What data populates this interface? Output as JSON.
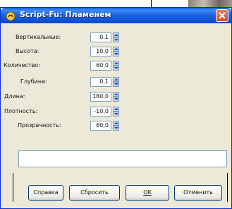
{
  "window": {
    "title": "Script-Fu: Пламенем",
    "accent": "#0a4fd6"
  },
  "params": [
    {
      "label": "Вертикальные:",
      "value": "0.1"
    },
    {
      "label": "Высота:",
      "value": "10,0"
    },
    {
      "label": "Количество:",
      "value": "60,0"
    },
    {
      "label": "Глубина:",
      "value": "0,1"
    },
    {
      "label": "Длина:",
      "value": "180,0"
    },
    {
      "label": "Плотность:",
      "value": "-10,0"
    },
    {
      "label": "Прозрачность:",
      "value": "60,0"
    }
  ],
  "message": "",
  "buttons": {
    "help": "Справка",
    "reset": "Сбросить",
    "ok": "OK",
    "cancel": "Отменить"
  },
  "icons": {
    "app": "script-fu-icon",
    "close": "close-icon",
    "spin": "spin-arrows-icon"
  }
}
